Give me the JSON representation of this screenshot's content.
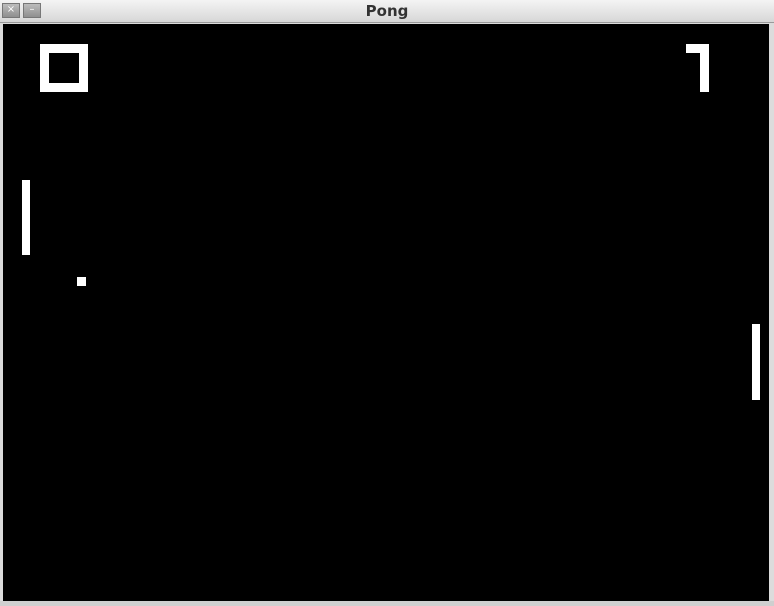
{
  "window": {
    "title": "Pong",
    "close_glyph": "×",
    "minimize_glyph": "–"
  },
  "colors": {
    "background": "#000000",
    "foreground": "#ffffff"
  },
  "score": {
    "left": "0",
    "right": "1"
  }
}
